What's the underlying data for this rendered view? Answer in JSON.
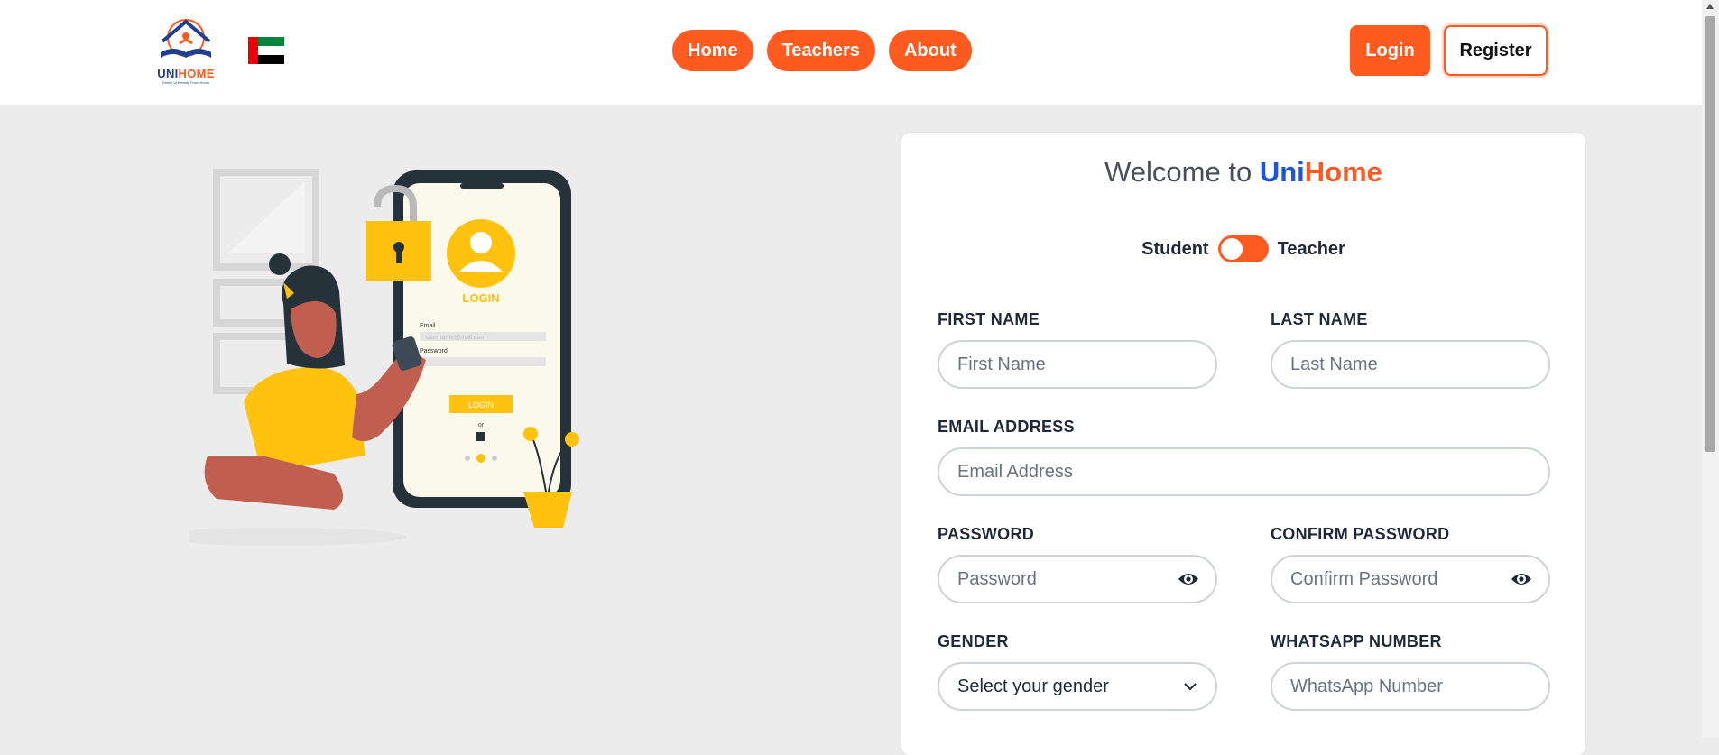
{
  "brand": {
    "uni": "UNI",
    "home": "HOME",
    "tagline": "Online University From Home"
  },
  "nav": {
    "home": "Home",
    "teachers": "Teachers",
    "about": "About"
  },
  "auth": {
    "login": "Login",
    "register": "Register"
  },
  "illustration": {
    "login_text": "LOGIN",
    "email_label": "Email",
    "email_hint": "username@mail.com",
    "password_label": "Password",
    "button": "LOGIN",
    "or": "or"
  },
  "form": {
    "welcome_prefix": "Welcome to ",
    "brand_uni": "Uni",
    "brand_home": "Home",
    "role_left": "Student",
    "role_right": "Teacher",
    "first_name": {
      "label": "FIRST NAME",
      "placeholder": "First Name"
    },
    "last_name": {
      "label": "LAST NAME",
      "placeholder": "Last Name"
    },
    "email": {
      "label": "EMAIL ADDRESS",
      "placeholder": "Email Address"
    },
    "password": {
      "label": "PASSWORD",
      "placeholder": "Password"
    },
    "confirm_password": {
      "label": "CONFIRM PASSWORD",
      "placeholder": "Confirm Password"
    },
    "gender": {
      "label": "GENDER",
      "selected": "Select your gender"
    },
    "whatsapp": {
      "label": "WHATSAPP NUMBER",
      "placeholder": "WhatsApp Number"
    }
  },
  "colors": {
    "accent": "#ff5a1f",
    "brand_blue": "#1d56d8",
    "background": "#ececec"
  }
}
